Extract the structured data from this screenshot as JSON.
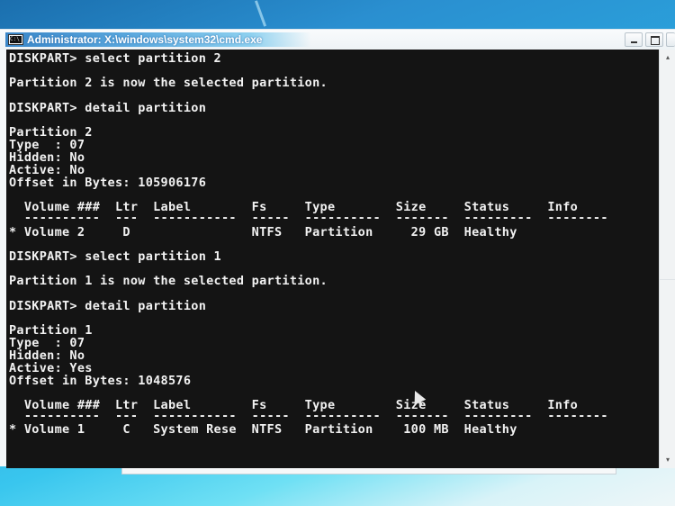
{
  "window": {
    "title": "Administrator: X:\\windows\\system32\\cmd.exe",
    "controls": {
      "minimize": "minimize",
      "maximize": "maximize",
      "close": "close"
    }
  },
  "console": {
    "lines": [
      "DISKPART> select partition 2",
      "",
      "Partition 2 is now the selected partition.",
      "",
      "DISKPART> detail partition",
      "",
      "Partition 2",
      "Type  : 07",
      "Hidden: No",
      "Active: No",
      "Offset in Bytes: 105906176",
      "",
      "  Volume ###  Ltr  Label        Fs     Type        Size     Status     Info",
      "  ----------  ---  -----------  -----  ----------  -------  ---------  --------",
      "* Volume 2     D                NTFS   Partition     29 GB  Healthy",
      "",
      "DISKPART> select partition 1",
      "",
      "Partition 1 is now the selected partition.",
      "",
      "DISKPART> detail partition",
      "",
      "Partition 1",
      "Type  : 07",
      "Hidden: No",
      "Active: Yes",
      "Offset in Bytes: 1048576",
      "",
      "  Volume ###  Ltr  Label        Fs     Type        Size     Status     Info",
      "  ----------  ---  -----------  -----  ----------  -------  ---------  --------",
      "* Volume 1     C   System Rese  NTFS   Partition    100 MB  Healthy"
    ],
    "partitions": [
      {
        "number": 2,
        "type": "07",
        "hidden": "No",
        "active": "No",
        "offset_bytes": "105906176",
        "volume": {
          "name": "Volume 2",
          "ltr": "D",
          "label": "",
          "fs": "NTFS",
          "type": "Partition",
          "size": "29 GB",
          "status": "Healthy",
          "info": ""
        }
      },
      {
        "number": 1,
        "type": "07",
        "hidden": "No",
        "active": "Yes",
        "offset_bytes": "1048576",
        "volume": {
          "name": "Volume 1",
          "ltr": "C",
          "label": "System Rese",
          "fs": "NTFS",
          "type": "Partition",
          "size": "100 MB",
          "status": "Healthy",
          "info": ""
        }
      }
    ],
    "table_headers": [
      "Volume ###",
      "Ltr",
      "Label",
      "Fs",
      "Type",
      "Size",
      "Status",
      "Info"
    ]
  },
  "scrollbar": {
    "up_arrow": "▴",
    "down_arrow": "▾"
  },
  "colors": {
    "console_bg": "#141414",
    "console_fg": "#f2f2f2",
    "title_accent": "#3a86c8"
  }
}
